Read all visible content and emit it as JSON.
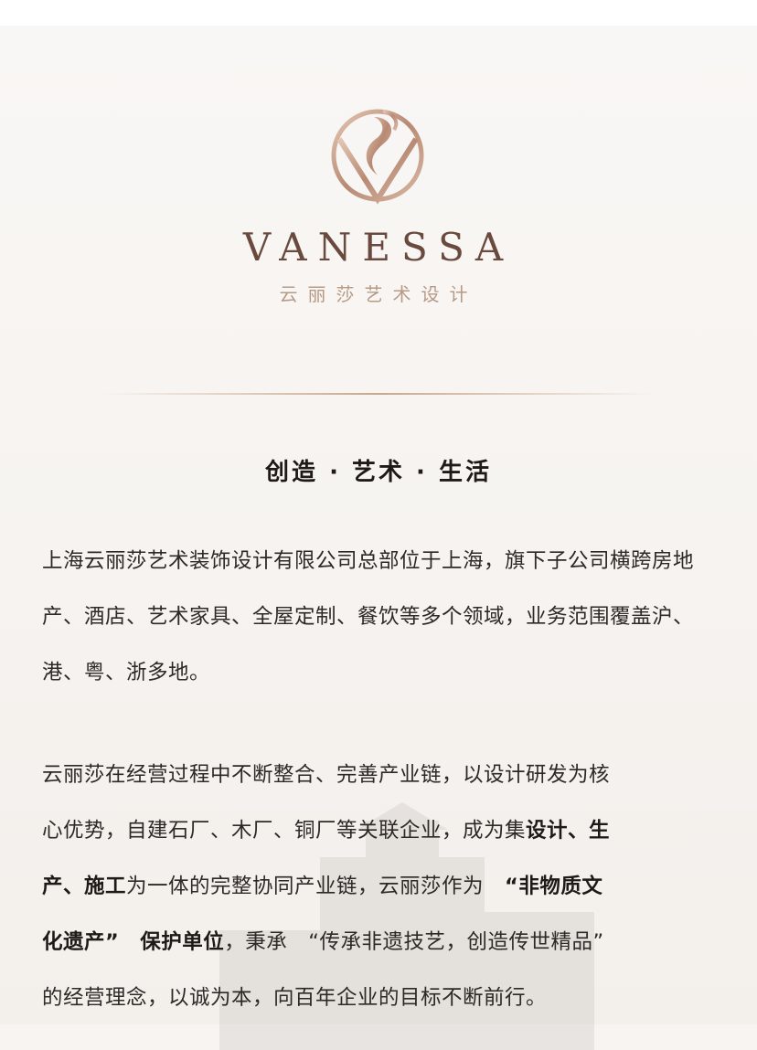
{
  "brand": {
    "name": "VANESSA",
    "subtitle": "云丽莎艺术设计",
    "colors": {
      "gold": "#c8a88c",
      "brown": "#6a4a3f"
    }
  },
  "slogan": "创造 · 艺术 · 生活",
  "paragraph1": "上海云丽莎艺术装饰设计有限公司总部位于上海，旗下子公司横跨房地产、酒店、艺术家具、全屋定制、餐饮等多个领域，业务范围覆盖沪、港、粤、浙多地。",
  "paragraph2": {
    "lines": [
      [
        {
          "text": "云丽莎在经营过程中不断整合、完善产业链，以设计研发为核",
          "bold": false
        }
      ],
      [
        {
          "text": "心优势，自建石厂、木厂、铜厂等关联企业，成为集",
          "bold": false
        },
        {
          "text": "设计、生",
          "bold": true
        }
      ],
      [
        {
          "text": "产、施工",
          "bold": true
        },
        {
          "text": "为一体的完整协同产业链，云丽莎作为　",
          "bold": false
        },
        {
          "text": "“非物质文",
          "bold": true
        }
      ],
      [
        {
          "text": "化遗产”　保护单位",
          "bold": true
        },
        {
          "text": "，秉承　“传承非遗技艺，创造传世精品”",
          "bold": false
        }
      ],
      [
        {
          "text": "的经营理念，以诚为本，向百年企业的目标不断前行。",
          "bold": false
        }
      ]
    ]
  }
}
